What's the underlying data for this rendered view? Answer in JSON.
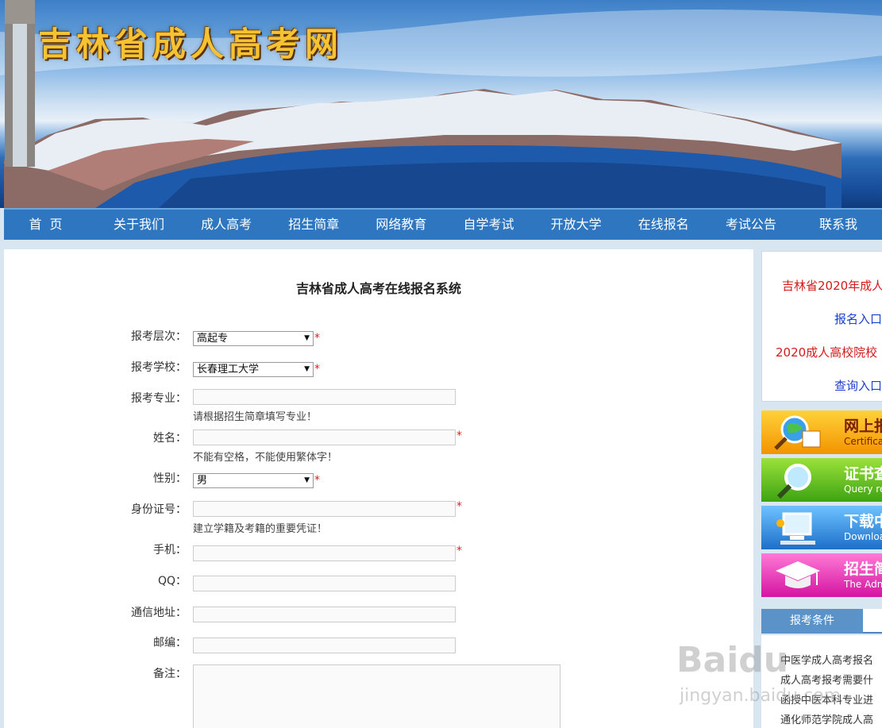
{
  "banner": {
    "site_title": "吉林省成人高考网"
  },
  "nav": {
    "items": [
      "首页",
      "关于我们",
      "成人高考",
      "招生简章",
      "网络教育",
      "自学考试",
      "开放大学",
      "在线报名",
      "考试公告",
      "联系我"
    ]
  },
  "form": {
    "title": "吉林省成人高考在线报名系统",
    "level_label": "报考层次：",
    "level_value": "高起专",
    "school_label": "报考学校：",
    "school_value": "长春理工大学",
    "major_label": "报考专业：",
    "major_hint": "请根据招生简章填写专业！",
    "name_label": "姓名：",
    "name_hint": "不能有空格，不能使用繁体字！",
    "gender_label": "性别：",
    "gender_value": "男",
    "id_label": "身份证号：",
    "id_hint": "建立学籍及考籍的重要凭证！",
    "phone_label": "手机：",
    "qq_label": "QQ：",
    "address_label": "通信地址：",
    "zip_label": "邮编：",
    "remark_label": "备注：",
    "required_mark": "*"
  },
  "sidebar": {
    "notice_1": "吉林省2020年成人",
    "link_1": "报名入口",
    "notice_2": "2020成人高校院校",
    "link_2": "查询入口",
    "btn_1_title": "网上报",
    "btn_1_sub": "Certifica",
    "btn_2_title": "证书查",
    "btn_2_sub": "Query res",
    "btn_3_title": "下载中",
    "btn_3_sub": "Downloa",
    "btn_4_title": "招生简",
    "btn_4_sub": "The Admiss",
    "tab_label": "报考条件",
    "list": [
      "中医学成人高考报名",
      "成人高考报考需要什",
      "函授中医本科专业进",
      "通化师范学院成人高"
    ]
  },
  "watermark": {
    "logo": "Baidu",
    "sub": "jingyan.baidu.com"
  },
  "colors": {
    "nav_bg": "#2e77c0",
    "required": "#e02020",
    "link_blue": "#1a3fd0",
    "notice_red": "#d41b1b"
  }
}
